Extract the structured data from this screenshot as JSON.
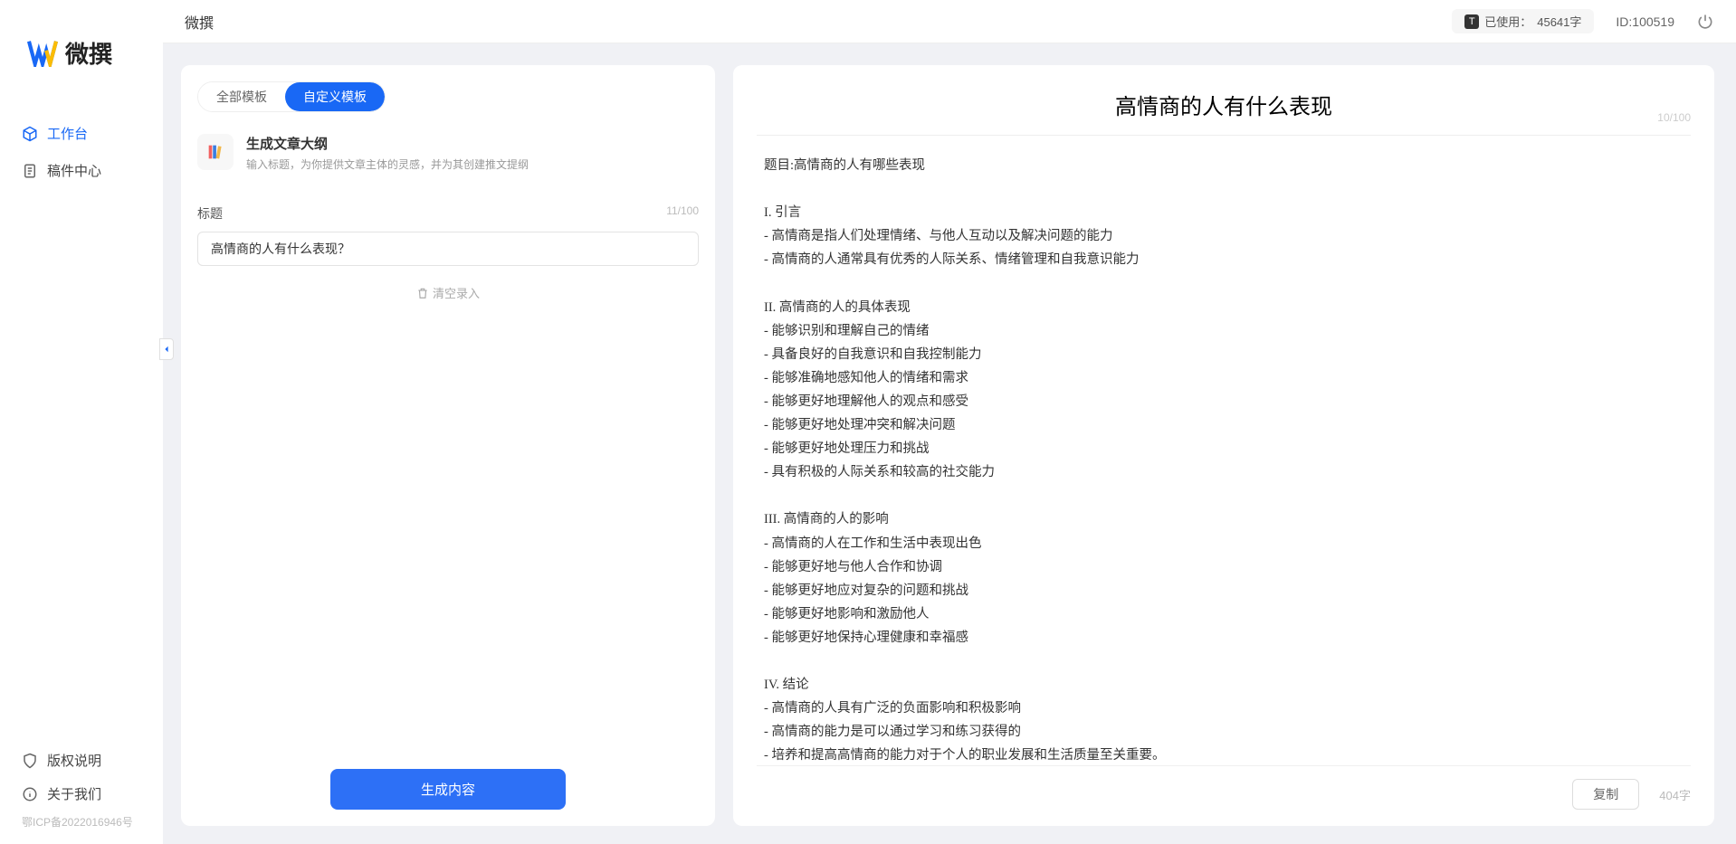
{
  "brand": {
    "name": "微撰"
  },
  "sidebar": {
    "nav": [
      {
        "label": "工作台",
        "active": true
      },
      {
        "label": "稿件中心",
        "active": false
      }
    ],
    "bottom": [
      {
        "label": "版权说明"
      },
      {
        "label": "关于我们"
      }
    ],
    "icp": "鄂ICP备2022016946号"
  },
  "topbar": {
    "title": "微撰",
    "usage_prefix": "已使用：",
    "usage_value": "45641字",
    "id_prefix": "ID:",
    "id_value": "100519"
  },
  "left": {
    "tabs": [
      {
        "label": "全部模板",
        "active": false
      },
      {
        "label": "自定义模板",
        "active": true
      }
    ],
    "template": {
      "title": "生成文章大纲",
      "desc": "输入标题，为你提供文章主体的灵感，并为其创建推文提纲"
    },
    "field": {
      "label": "标题",
      "counter": "11/100",
      "value": "高情商的人有什么表现？"
    },
    "clear": "清空录入",
    "generate": "生成内容"
  },
  "right": {
    "title": "高情商的人有什么表现",
    "title_counter": "10/100",
    "content": "题目:高情商的人有哪些表现\n\nI. 引言\n- 高情商是指人们处理情绪、与他人互动以及解决问题的能力\n- 高情商的人通常具有优秀的人际关系、情绪管理和自我意识能力\n\nII. 高情商的人的具体表现\n- 能够识别和理解自己的情绪\n- 具备良好的自我意识和自我控制能力\n- 能够准确地感知他人的情绪和需求\n- 能够更好地理解他人的观点和感受\n- 能够更好地处理冲突和解决问题\n- 能够更好地处理压力和挑战\n- 具有积极的人际关系和较高的社交能力\n\nIII. 高情商的人的影响\n- 高情商的人在工作和生活中表现出色\n- 能够更好地与他人合作和协调\n- 能够更好地应对复杂的问题和挑战\n- 能够更好地影响和激励他人\n- 能够更好地保持心理健康和幸福感\n\nIV. 结论\n- 高情商的人具有广泛的负面影响和积极影响\n- 高情商的能力是可以通过学习和练习获得的\n- 培养和提高高情商的能力对于个人的职业发展和生活质量至关重要。",
    "copy": "复制",
    "word_count": "404字"
  }
}
